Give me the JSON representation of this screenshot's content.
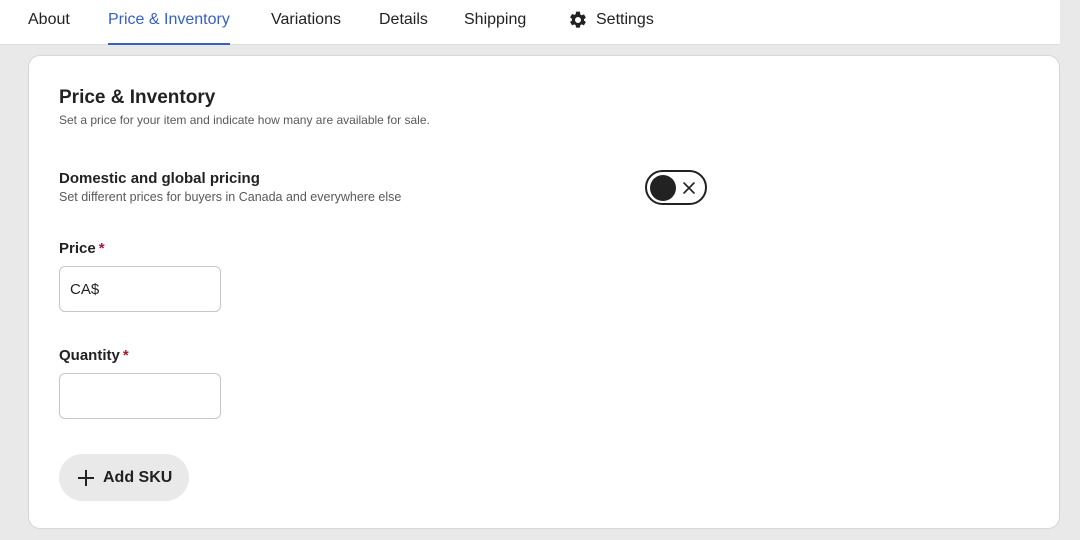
{
  "tabs": [
    {
      "label": "About"
    },
    {
      "label": "Price & Inventory"
    },
    {
      "label": "Variations"
    },
    {
      "label": "Details"
    },
    {
      "label": "Shipping"
    },
    {
      "label": "Settings",
      "icon": "gear-icon"
    }
  ],
  "active_tab": "Price & Inventory",
  "section": {
    "title": "Price & Inventory",
    "subtitle": "Set a price for your item and indicate how many are available for sale."
  },
  "pricing": {
    "label": "Domestic and global pricing",
    "description": "Set different prices for buyers in Canada and everywhere else",
    "toggle_on": false
  },
  "price": {
    "label": "Price",
    "required_mark": "*",
    "prefix": "CA$",
    "value": ""
  },
  "quantity": {
    "label": "Quantity",
    "required_mark": "*",
    "value": ""
  },
  "add_sku": {
    "label": "Add SKU",
    "icon": "plus-icon"
  },
  "colors": {
    "accent": "#3660c7",
    "required": "#a61a2e",
    "page_bg": "#e9e9e9"
  }
}
